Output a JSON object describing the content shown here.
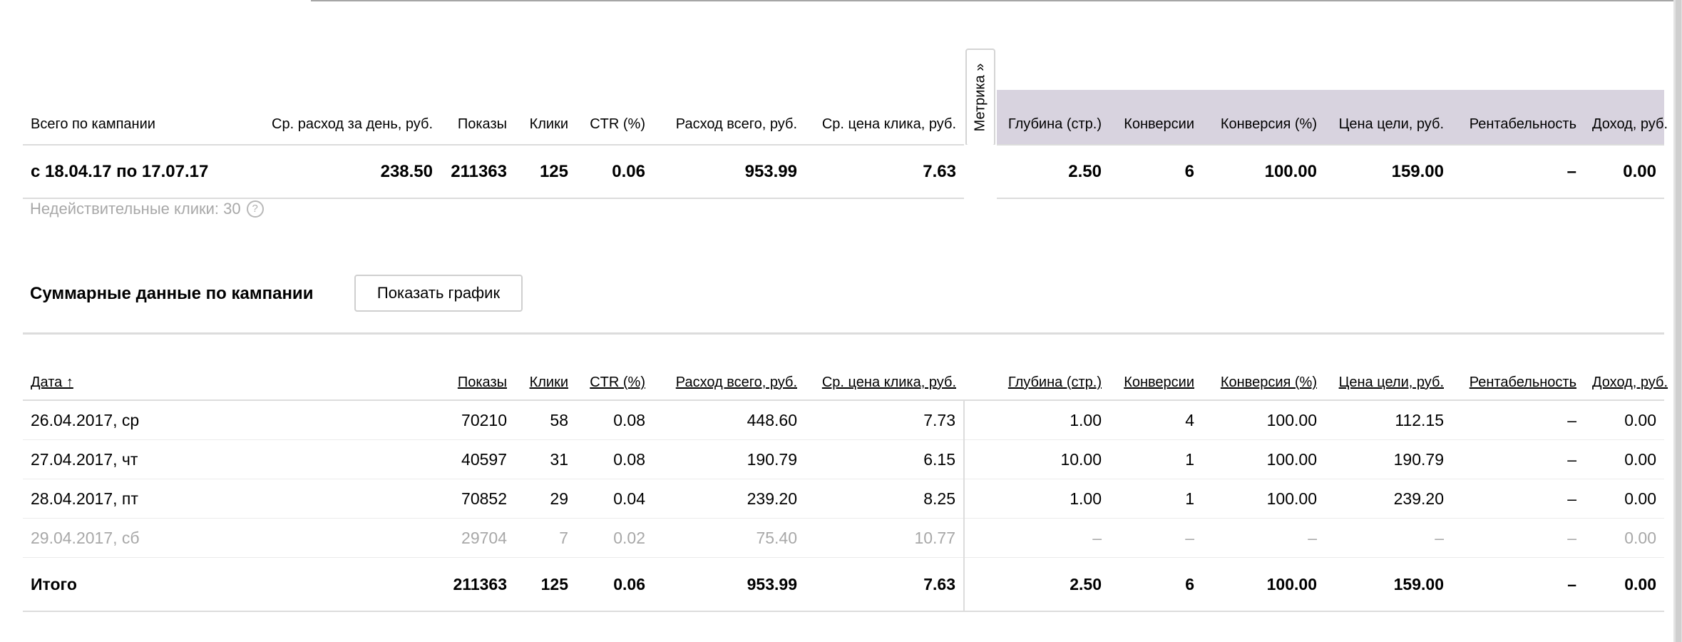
{
  "summary": {
    "headers": {
      "period": "Всего по кампании",
      "avg_daily": "Ср. расход за день, руб.",
      "impressions": "Показы",
      "clicks": "Клики",
      "ctr": "CTR (%)",
      "spend": "Расход всего, руб.",
      "cpc": "Ср. цена клика, руб.",
      "depth": "Глубина (стр.)",
      "conversions": "Конверсии",
      "conv_rate": "Конверсия (%)",
      "goal_cost": "Цена цели, руб.",
      "profitability": "Рентабельность",
      "revenue": "Доход, руб."
    },
    "row": {
      "period": "с 18.04.17 по 17.07.17",
      "avg_daily": "238.50",
      "impressions": "211363",
      "clicks": "125",
      "ctr": "0.06",
      "spend": "953.99",
      "cpc": "7.63",
      "depth": "2.50",
      "conversions": "6",
      "conv_rate": "100.00",
      "goal_cost": "159.00",
      "profitability": "–",
      "revenue": "0.00"
    },
    "metrika_tab": "Метрика »"
  },
  "invalid_clicks": "Недействительные клики: 30",
  "section": {
    "title": "Суммарные данные по кампании",
    "show_chart_button": "Показать график"
  },
  "detail": {
    "headers": {
      "date": "Дата ↑",
      "impressions": "Показы",
      "clicks": "Клики",
      "ctr": "CTR (%)",
      "spend": "Расход всего, руб.",
      "cpc": "Ср. цена клика, руб.",
      "depth": "Глубина (стр.)",
      "conversions": "Конверсии",
      "conv_rate": "Конверсия (%)",
      "goal_cost": "Цена цели, руб.",
      "profitability": "Рентабельность",
      "revenue": "Доход, руб."
    },
    "rows": [
      {
        "date": "26.04.2017, ср",
        "impressions": "70210",
        "clicks": "58",
        "ctr": "0.08",
        "spend": "448.60",
        "cpc": "7.73",
        "depth": "1.00",
        "conversions": "4",
        "conv_rate": "100.00",
        "goal_cost": "112.15",
        "profitability": "–",
        "revenue": "0.00"
      },
      {
        "date": "27.04.2017, чт",
        "impressions": "40597",
        "clicks": "31",
        "ctr": "0.08",
        "spend": "190.79",
        "cpc": "6.15",
        "depth": "10.00",
        "conversions": "1",
        "conv_rate": "100.00",
        "goal_cost": "190.79",
        "profitability": "–",
        "revenue": "0.00"
      },
      {
        "date": "28.04.2017, пт",
        "impressions": "70852",
        "clicks": "29",
        "ctr": "0.04",
        "spend": "239.20",
        "cpc": "8.25",
        "depth": "1.00",
        "conversions": "1",
        "conv_rate": "100.00",
        "goal_cost": "239.20",
        "profitability": "–",
        "revenue": "0.00"
      },
      {
        "date": "29.04.2017, сб",
        "impressions": "29704",
        "clicks": "7",
        "ctr": "0.02",
        "spend": "75.40",
        "cpc": "10.77",
        "depth": "–",
        "conversions": "–",
        "conv_rate": "–",
        "goal_cost": "–",
        "profitability": "–",
        "revenue": "0.00"
      }
    ],
    "total": {
      "label": "Итого",
      "impressions": "211363",
      "clicks": "125",
      "ctr": "0.06",
      "spend": "953.99",
      "cpc": "7.63",
      "depth": "2.50",
      "conversions": "6",
      "conv_rate": "100.00",
      "goal_cost": "159.00",
      "profitability": "–",
      "revenue": "0.00"
    }
  }
}
